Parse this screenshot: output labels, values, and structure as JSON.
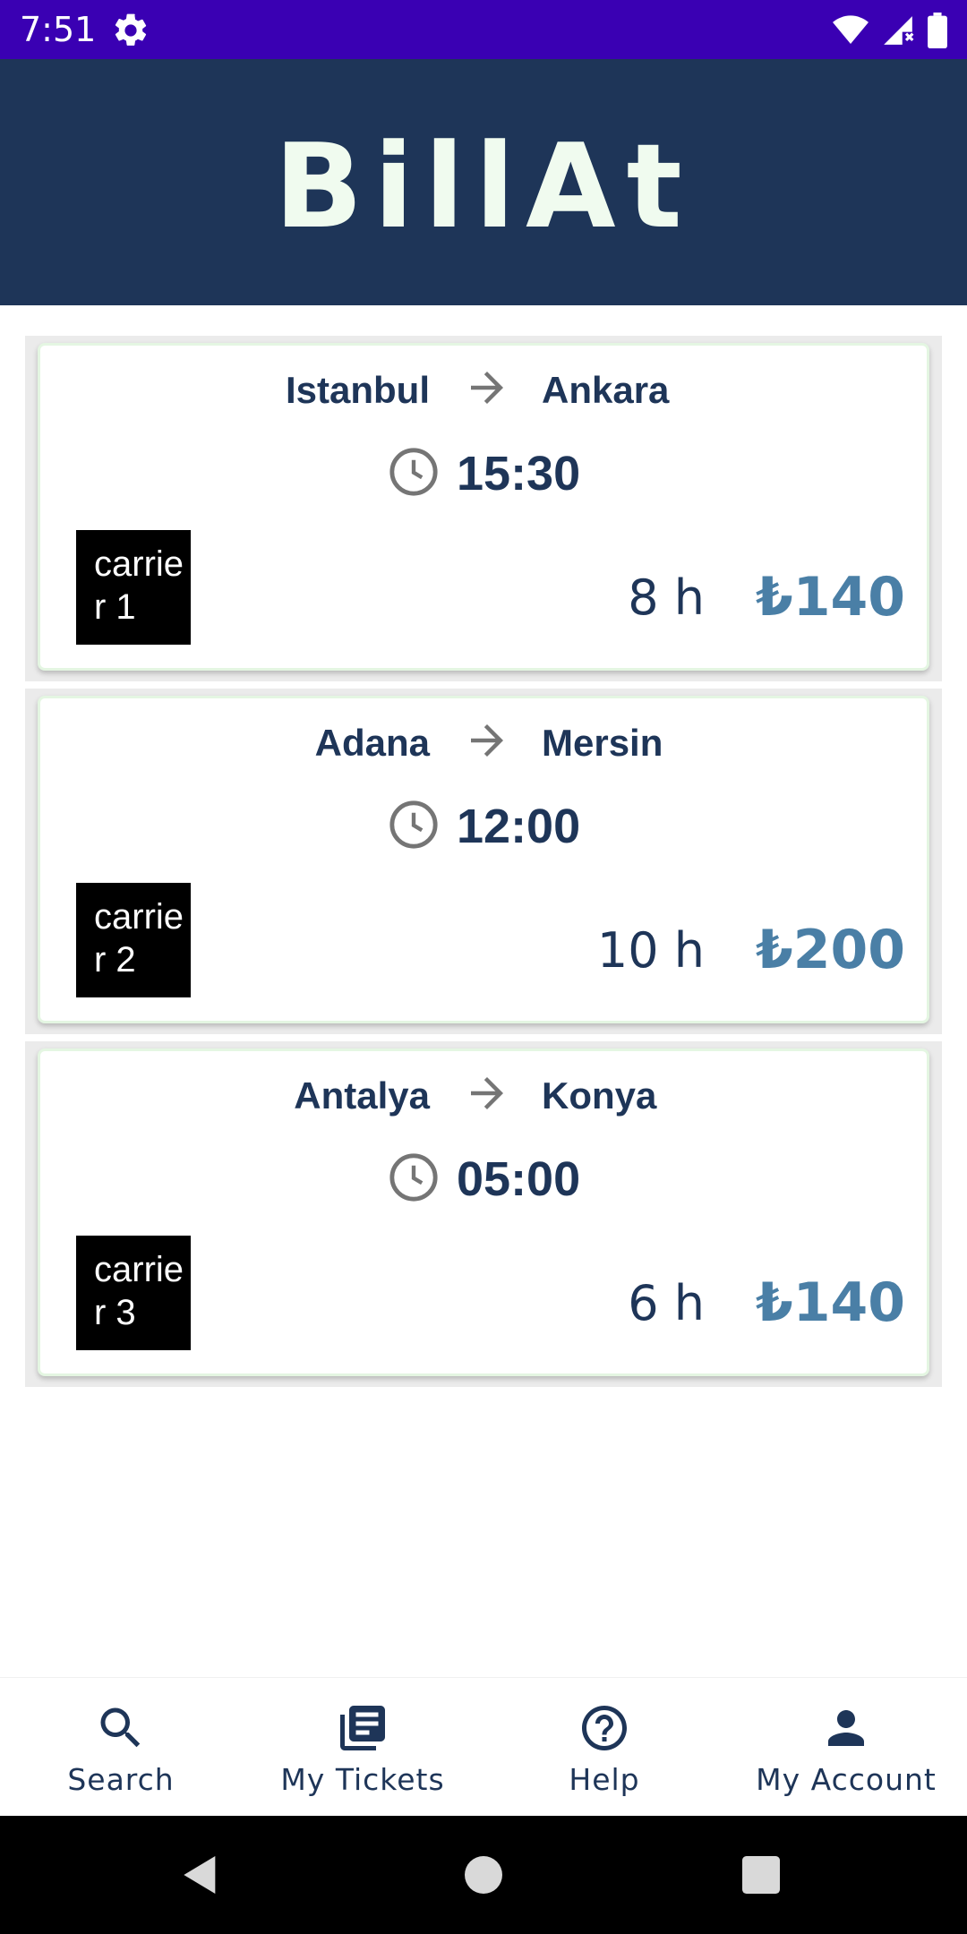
{
  "status_bar": {
    "time": "7:51"
  },
  "app": {
    "title": "BillAt"
  },
  "trips": [
    {
      "from": "Istanbul",
      "to": "Ankara",
      "departure": "15:30",
      "carrier": "carrier 1",
      "duration": "8 h",
      "price": "₺140"
    },
    {
      "from": "Adana",
      "to": "Mersin",
      "departure": "12:00",
      "carrier": "carrier 2",
      "duration": "10 h",
      "price": "₺200"
    },
    {
      "from": "Antalya",
      "to": "Konya",
      "departure": "05:00",
      "carrier": "carrier 3",
      "duration": "6 h",
      "price": "₺140"
    }
  ],
  "bottom_nav": {
    "items": [
      {
        "label": "Search",
        "icon": "search-icon"
      },
      {
        "label": "My Tickets",
        "icon": "tickets-icon"
      },
      {
        "label": "Help",
        "icon": "help-icon"
      },
      {
        "label": "My Account",
        "icon": "account-icon"
      }
    ]
  },
  "colors": {
    "status_bar": "#3a00b3",
    "app_bar": "#1e3558",
    "title": "#f0fbef",
    "price": "#4a7fa6",
    "text": "#1e3558"
  }
}
